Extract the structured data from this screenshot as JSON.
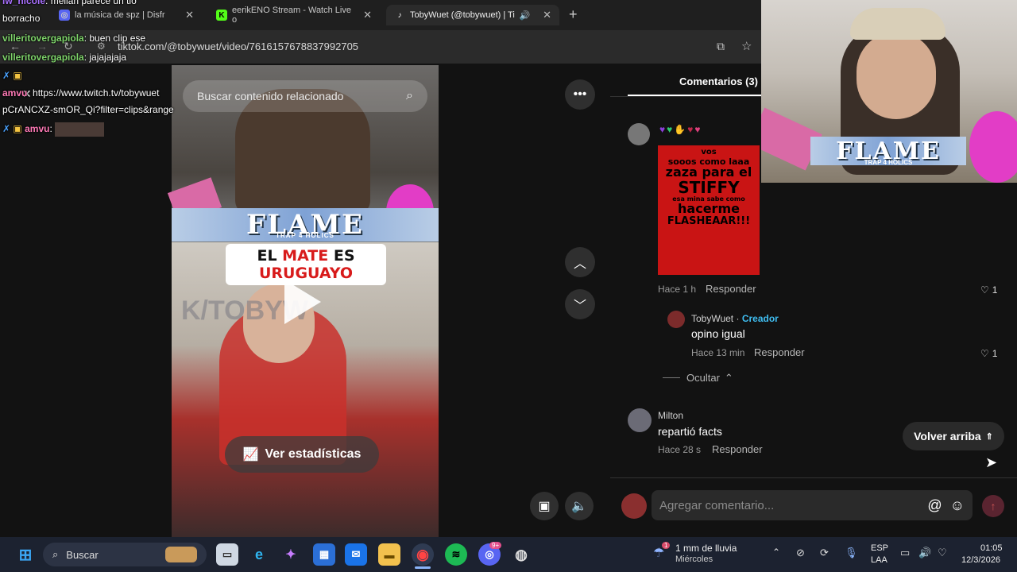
{
  "browser": {
    "tabs": [
      {
        "title": "la música de spz | Disfr",
        "favicon": "discord-icon",
        "color": "#5865f2"
      },
      {
        "title": "eerikENO Stream - Watch Live o",
        "favicon": "kick-icon",
        "color": "#53fc18"
      },
      {
        "title": "TobyWuet (@tobywuet) | Ti",
        "favicon": "tiktok-icon",
        "color": "#ffffff"
      }
    ],
    "url": "tiktok.com/@tobywuet/video/7616157678837992705"
  },
  "video": {
    "search_placeholder": "Buscar contenido relacionado",
    "flame_text": "FLAME",
    "flame_sub": "TRAP 4 HOLICS",
    "banner_line1_a": "EL ",
    "banner_line1_b": "MATE",
    "banner_line1_c": " ES",
    "banner_line2": "URUGUAYO",
    "watermark": "K/TOBYW",
    "stats_label": "Ver estadísticas"
  },
  "comments": {
    "tab_label": "Comentarios (3)",
    "items": [
      {
        "meme_lines": [
          "vos",
          "sooos como laaa",
          "zaza para el",
          "STIFFY",
          "esa mina sabe como",
          "hacerme",
          "FLASHEAAR!!!"
        ],
        "time": "Hace 1 h",
        "reply_label": "Responder",
        "likes": "1"
      },
      {
        "author": "TobyWuet",
        "badge": "Creador",
        "separator": "·",
        "text": "opino igual",
        "time": "Hace 13 min",
        "reply_label": "Responder",
        "likes": "1"
      },
      {
        "author": "Milton",
        "text": "repartió facts",
        "time": "Hace 28 s",
        "reply_label": "Responder"
      }
    ],
    "hide_label": "Ocultar",
    "back_to_top": "Volver arriba",
    "add_placeholder": "Agregar comentario..."
  },
  "chat_overlay": [
    {
      "user": "lw_nicole",
      "text": ": meilan parece un tio",
      "color": "#a970ff"
    },
    {
      "user": "",
      "text": "borracho",
      "color": "#ffffff"
    },
    {
      "user": "villeritovergapiola",
      "text": ": buen clip ese",
      "color": "#7fd46b"
    },
    {
      "user": "villeritovergapiola",
      "text": ": jajajajaja",
      "color": "#7fd46b"
    },
    {
      "user": "amvu",
      "text": ": https://www.twitch.tv/tobywuet",
      "color": "#ff7ab6"
    },
    {
      "user": "",
      "text": "pCrANCXZ-smOR_Qi?filter=clips&range",
      "color": "#ffffff"
    },
    {
      "user": "amvu",
      "text": ":",
      "color": "#ff7ab6"
    }
  ],
  "webcam": {
    "flame_text": "FLAME",
    "flame_sub": "TRAP 4 HOLICS"
  },
  "taskbar": {
    "search_label": "Buscar",
    "weather_line1": "1 mm de lluvia",
    "weather_line2": "Miércoles",
    "lang_line1": "ESP",
    "lang_line2": "LAA",
    "time": "01:05",
    "date": "12/3/2026",
    "notification_badge": "9+",
    "weather_badge": "1"
  },
  "colors": {
    "creator_badge": "#3fbdf0",
    "chrome_accent": "#1f1f1f",
    "taskbar": "#1c2230"
  }
}
